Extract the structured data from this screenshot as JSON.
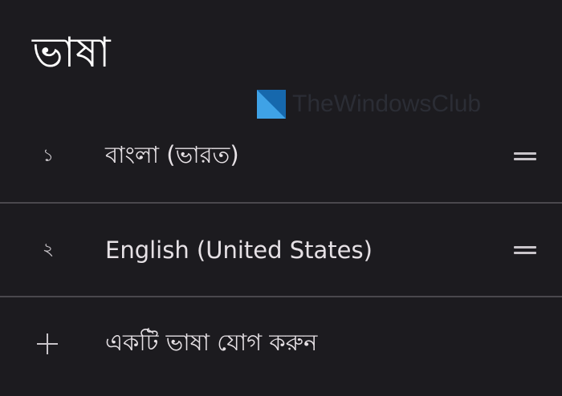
{
  "page": {
    "title": "ভাষা"
  },
  "watermark": {
    "text": "TheWindowsClub",
    "icon": "windows-logo-icon"
  },
  "languages": [
    {
      "index": "১",
      "label": "বাংলা (ভারত)",
      "handle_icon": "drag-handle-icon"
    },
    {
      "index": "২",
      "label": "English (United States)",
      "handle_icon": "drag-handle-icon"
    }
  ],
  "add_language": {
    "icon": "plus-icon",
    "label": "একটি ভাষা যোগ করুন"
  },
  "colors": {
    "background": "#1c1b1f",
    "text": "#e6e1e5",
    "divider": "#4a484d",
    "watermark_blue": "#1e7fc8"
  }
}
